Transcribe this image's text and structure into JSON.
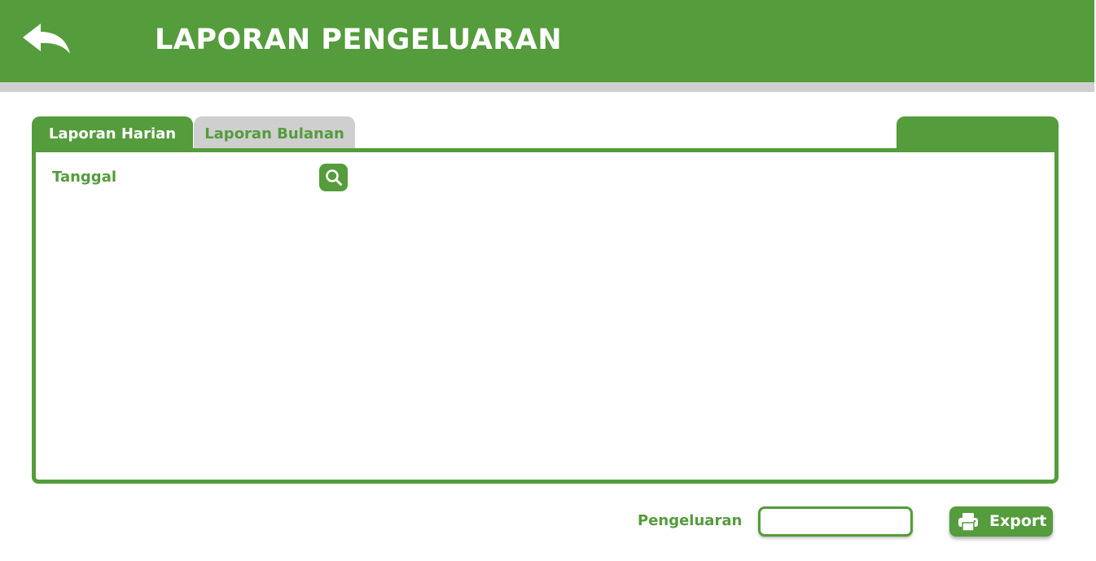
{
  "header": {
    "title": "LAPORAN PENGELUARAN",
    "back_icon": "back-arrow-icon",
    "background_color": "#549c3c"
  },
  "tabs": [
    {
      "label": "Laporan Harian",
      "active": true
    },
    {
      "label": "Laporan Bulanan",
      "active": false
    }
  ],
  "filter": {
    "date_label": "Tanggal",
    "search_icon": "search-icon"
  },
  "footer": {
    "total_label": "Pengeluaran",
    "total_value": "",
    "export_label": "Export",
    "export_icon": "printer-icon"
  },
  "colors": {
    "accent": "#549c3c",
    "inactive_tab": "#cfcfcf",
    "text_light": "#ffffff"
  }
}
